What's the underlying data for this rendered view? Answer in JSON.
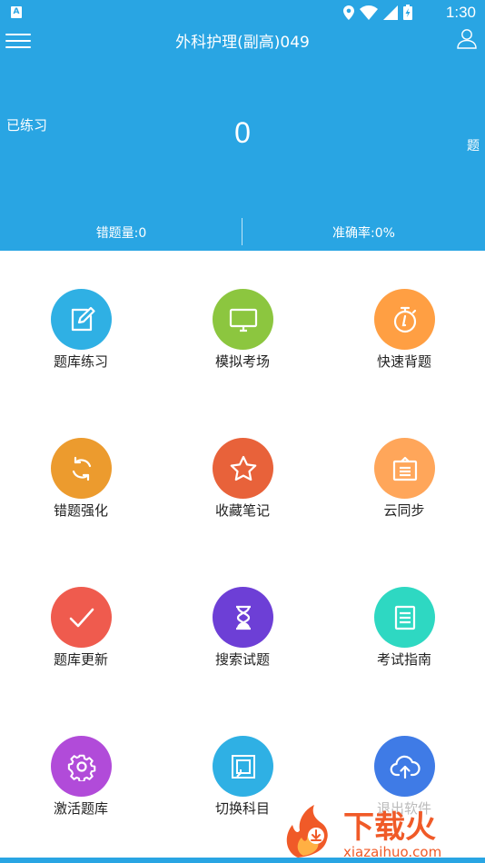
{
  "status_bar": {
    "app_badge": "A",
    "time": "1:30"
  },
  "header": {
    "title": "外科护理(副高)049",
    "practiced_label": "已练习",
    "practiced_count": "0",
    "unit": "题",
    "wrong_count": "错题量:0",
    "accuracy": "准确率:0%"
  },
  "tiles": [
    {
      "label": "题库练习",
      "icon": "edit-icon",
      "color": "#2fb0e4"
    },
    {
      "label": "模拟考场",
      "icon": "monitor-icon",
      "color": "#8cc63f"
    },
    {
      "label": "快速背题",
      "icon": "stopwatch-icon",
      "color": "#ff9f43"
    },
    {
      "label": "错题强化",
      "icon": "refresh-icon",
      "color": "#ec9b2e"
    },
    {
      "label": "收藏笔记",
      "icon": "star-icon",
      "color": "#e8623a"
    },
    {
      "label": "云同步",
      "icon": "clipboard-icon",
      "color": "#ffa65a"
    },
    {
      "label": "题库更新",
      "icon": "check-icon",
      "color": "#ef5b4e"
    },
    {
      "label": "搜索试题",
      "icon": "hourglass-icon",
      "color": "#6d3fd6"
    },
    {
      "label": "考试指南",
      "icon": "list-icon",
      "color": "#2ed8c2"
    },
    {
      "label": "激活题库",
      "icon": "gear-icon",
      "color": "#b14bd9"
    },
    {
      "label": "切换科目",
      "icon": "switch-icon",
      "color": "#2fb0e4"
    },
    {
      "label": "退出软件",
      "icon": "cloud-upload-icon",
      "color": "#3f7be6"
    }
  ],
  "watermark": {
    "brand": "下载火",
    "url": "xiazaihuo.com"
  }
}
